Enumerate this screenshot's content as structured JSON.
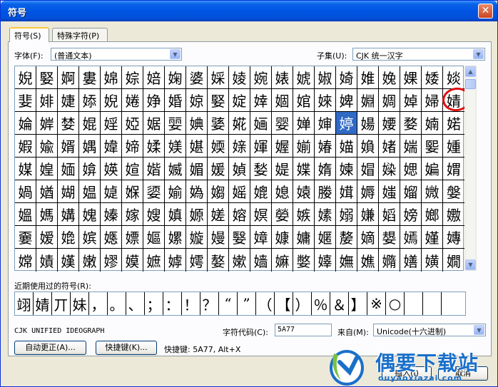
{
  "window": {
    "title": "符号",
    "close_glyph": "✕"
  },
  "tabs": [
    {
      "label": "符号(S)",
      "active": true
    },
    {
      "label": "特殊字符(P)",
      "active": false
    }
  ],
  "font": {
    "label": "字体(F):",
    "value": "(普通文本)"
  },
  "subset": {
    "label": "子集(U):",
    "value": "CJK 统一汉字"
  },
  "symbols": {
    "rows": [
      [
        "婗",
        "婜",
        "婀",
        "婁",
        "婂",
        "婃",
        "婄",
        "婅",
        "婆",
        "婇",
        "婈",
        "婉",
        "婊",
        "婋",
        "婌",
        "婍",
        "婎",
        "婏",
        "婐",
        "婑",
        "婒"
      ],
      [
        "婓",
        "婔",
        "婕",
        "婖",
        "婗",
        "婘",
        "婙",
        "婚",
        "婛",
        "婜",
        "婝",
        "婞",
        "婟",
        "婠",
        "婡",
        "婢",
        "婣",
        "婤",
        "婥",
        "婦",
        "婧"
      ],
      [
        "婨",
        "婩",
        "婪",
        "婫",
        "婬",
        "婭",
        "婮",
        "婯",
        "婰",
        "婱",
        "婲",
        "婳",
        "婴",
        "婵",
        "婶",
        "婷",
        "婸",
        "婹",
        "婺",
        "婻",
        "婼"
      ],
      [
        "婽",
        "婾",
        "婿",
        "媀",
        "媁",
        "媂",
        "媃",
        "媄",
        "媅",
        "媆",
        "媇",
        "媈",
        "媉",
        "媊",
        "媋",
        "媌",
        "媍",
        "媎",
        "媏",
        "媐",
        "媑"
      ],
      [
        "媒",
        "媓",
        "媔",
        "媕",
        "媖",
        "媗",
        "媘",
        "媙",
        "媚",
        "媛",
        "媜",
        "媝",
        "媞",
        "媟",
        "媠",
        "媡",
        "媢",
        "媣",
        "媤",
        "媥",
        "媦"
      ],
      [
        "媧",
        "媨",
        "媩",
        "媪",
        "媫",
        "媬",
        "媭",
        "媮",
        "媯",
        "媰",
        "媱",
        "媲",
        "媳",
        "媴",
        "媵",
        "媶",
        "媷",
        "媸",
        "媹",
        "媺",
        "媻"
      ],
      [
        "媼",
        "媽",
        "媾",
        "媿",
        "嫀",
        "嫁",
        "嫂",
        "嫃",
        "嫄",
        "嫅",
        "嫆",
        "嫇",
        "嫈",
        "嫉",
        "嫊",
        "嫋",
        "嫌",
        "嫍",
        "嫎",
        "嫏",
        "嫐"
      ],
      [
        "嫑",
        "嫒",
        "嫓",
        "嫔",
        "嫕",
        "嫖",
        "嫗",
        "嫘",
        "嫙",
        "嫚",
        "嫛",
        "嫜",
        "嫝",
        "嫞",
        "嫟",
        "嫠",
        "嫡",
        "嫢",
        "嫣",
        "嫤",
        "嫥"
      ],
      [
        "嫦",
        "嫧",
        "嫨",
        "嫩",
        "嫪",
        "嫫",
        "嫬",
        "嫭",
        "嫮",
        "嫯",
        "嫰",
        "嫱",
        "嫲",
        "嫳",
        "嫴",
        "嫵",
        "嫶",
        "嫷",
        "嫸",
        "嫹",
        "嫺"
      ]
    ],
    "selected_row": 2,
    "selected_col": 15
  },
  "recent": {
    "label": "近期使用过的符号(R):",
    "items": [
      "翊",
      "婧",
      "丌",
      "妹",
      "，",
      "。",
      "、",
      "；",
      "：",
      "！",
      "？",
      "“",
      "”",
      "（",
      "【",
      "）",
      "％",
      "＆",
      "】",
      "※",
      "○",
      "",
      "",
      ""
    ]
  },
  "char_name": "CJK UNIFIED IDEOGRAPH",
  "char_code": {
    "label": "字符代码(C):",
    "value": "5A77"
  },
  "from": {
    "label": "来自(M):",
    "value": "Unicode(十六进制)"
  },
  "buttons": {
    "autocorrect": "自动更正(A)...",
    "shortcut_key": "快捷键(K)...",
    "insert": "插入(I)",
    "cancel": "取消"
  },
  "shortcut_text": "快捷键: 5A77, Alt+X",
  "watermark": {
    "title": "偶要下载站",
    "url": "ouyaoxiazai.com"
  },
  "colors": {
    "selection": "#316ac5",
    "annotation": "#e01010",
    "brand": "#1a6fc9"
  }
}
